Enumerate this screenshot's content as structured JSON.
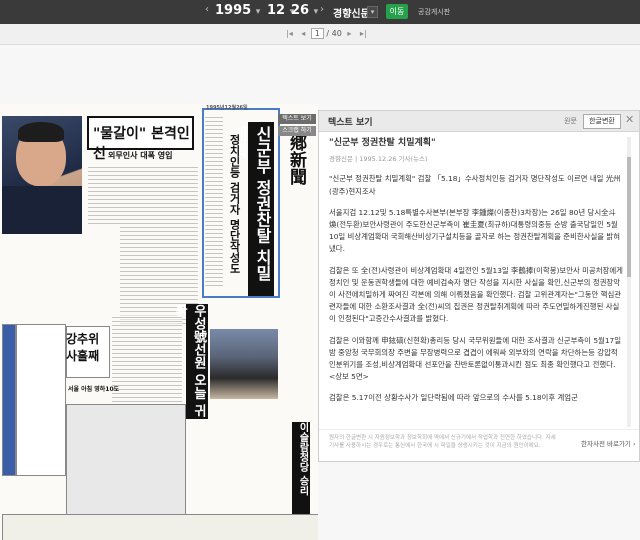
{
  "header": {
    "year": "1995",
    "month": "12",
    "day": "26",
    "paper_name": "경향신문",
    "go_label": "이동",
    "notice_link": "공감게시판"
  },
  "pager": {
    "current_page": "1",
    "total_pages": "40"
  },
  "newspaper": {
    "headline_box": "\"물갈이\" 본격인선",
    "subhead_1": "외무인사 대폭 영입",
    "vertical_big": "신군부 정권찬탈 치밀계획",
    "vertical_2": "정치인등 검거자 명단작성도",
    "masthead": "鄕新聞",
    "headline_3": "우성號선원 오늘 귀환",
    "ad_1": "강추위 사흘째",
    "ad_1_sub": "서울 아침 영하10도",
    "bottom_vert": "이슬람청당 승리",
    "masthead_right": "1995년12월26일"
  },
  "side_buttons": {
    "text_view": "텍스트 보기",
    "scrap": "스크랩 하기"
  },
  "panel": {
    "title": "텍스트 보기",
    "original_label": "원문",
    "hanja_button": "한글변환",
    "close": "✕",
    "article_title": "\"신군부 정권찬탈 치밀계획\"",
    "meta": "경향신문 | 1995.12.26 기사(뉴스)",
    "p1": "\"신군부 정권찬탈 치밀계획\" 검찰 「5.18」수사정치인등 검거자 명단작성도 이르면 내일 光州(광주)현지조사",
    "p2": "서울지검 12.12및 5.18특별수사본부(본부장 李鍾燦(이종찬)3차장)는 26일 80년 당시全斗煥(전두환)보안사령관이 주도한신군부측이 崔圭夏(최규하)대통령의중등 순방 출국당일인 5월10일 비상계엄확대 국회해산비상기구설치등을 골자로 하는 정권찬탈계획을 준비한사실을 밝혀냈다.",
    "p3": "검찰은 또 全(전)사령관이 비상계엄확대 4일전인 5월13일 李鶴捧(이학봉)보안사 미공처장에게 정치인 및 운동권학생들에 대한 예비검속자 명단 작성을 지시한 사실을 확인,신군부의 정권장악이 사전에치밀하게 짜여진 각본에 의해 이뤄졌음을 확인했다. 검찰 고위관계자는\"그동안 핵심관련자들에 대한 소환조사결과 全(전)씨의 집권은 정권탈취계획에 따라 주도면밀하게진행된 사실이 인정된다\"고증간수사결과를 밝혔다.",
    "p4": "검찰은 이와함께 申鉉碻(신현확)총리등 당시 국무위원들에 대한 조사결과 신군부측이 5월17일 밤 중앙청 국무회의장 주변을 무장병력으로 겹겹이 에워싸 외부와의 연락을 차단하는등 강압적인분위기를 조성,비상계엄확대 선포안을 찬반토론없이통과시킨 점도 최종 확인했다고 전했다. <상보 5면>",
    "p5": "검찰은 5.17이전 상황수사가 일단락됨에 따라 앞으로의 수사를 5.18이후 계엄군",
    "foot_note": "원자의 한글변환 시 자원정보학과 정보학회에 역에서 신규기에서 작업학과 전연한 하였습니다. 자세 기사를 사용하시는 경우로는 통신에서 한국에 시 파일을 상생시키는 것이 지금의 원인이에요.",
    "dict_link": "한자사전 바로가기 ›"
  }
}
